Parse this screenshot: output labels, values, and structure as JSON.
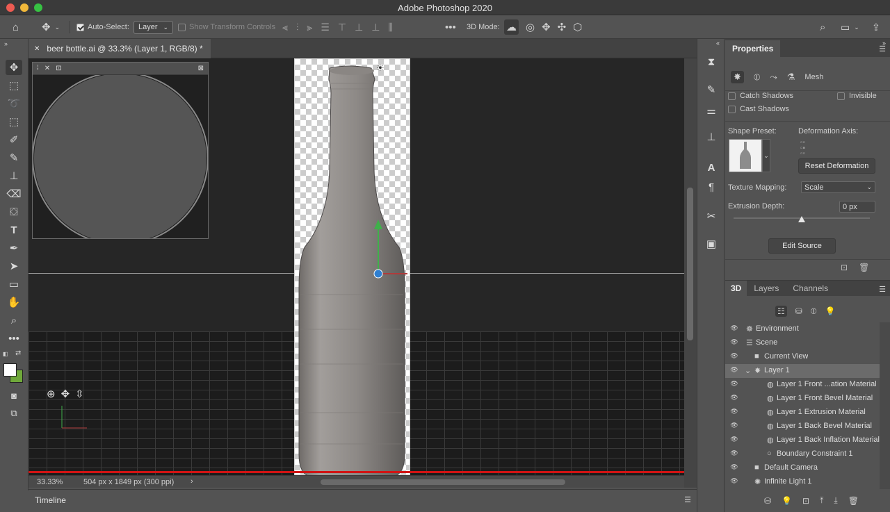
{
  "app": {
    "title": "Adobe Photoshop 2020"
  },
  "options_bar": {
    "auto_select_label": "Auto-Select:",
    "auto_select_value": "Layer",
    "show_transform_label": "Show Transform Controls",
    "mode_3d_label": "3D Mode:"
  },
  "document": {
    "tab_title": "beer bottle.ai @ 33.3% (Layer 1, RGB/8) *",
    "zoom": "33.33%",
    "dimensions": "504 px x 1849 px (300 ppi)"
  },
  "timeline": {
    "label": "Timeline"
  },
  "properties": {
    "tab_label": "Properties",
    "mesh_label": "Mesh",
    "catch_shadows": "Catch Shadows",
    "invisible": "Invisible",
    "cast_shadows": "Cast Shadows",
    "shape_preset_label": "Shape Preset:",
    "deformation_axis_label": "Deformation Axis:",
    "reset_deformation": "Reset Deformation",
    "texture_mapping_label": "Texture Mapping:",
    "texture_mapping_value": "Scale",
    "extrusion_depth_label": "Extrusion Depth:",
    "extrusion_depth_value": "0 px",
    "extrusion_slider_level": 0.5,
    "edit_source": "Edit Source"
  },
  "panel3d": {
    "tabs": [
      "3D",
      "Layers",
      "Channels"
    ],
    "items": [
      {
        "label": "Environment",
        "icon": "environment-icon"
      },
      {
        "label": "Scene",
        "icon": "scene-icon"
      },
      {
        "label": "Current View",
        "icon": "camera-icon"
      },
      {
        "label": "Layer 1",
        "icon": "mesh-icon",
        "selected": true
      },
      {
        "label": "Layer 1 Front ...ation Material",
        "icon": "material-icon"
      },
      {
        "label": "Layer 1 Front Bevel Material",
        "icon": "material-icon"
      },
      {
        "label": "Layer 1 Extrusion Material",
        "icon": "material-icon"
      },
      {
        "label": "Layer 1 Back Bevel Material",
        "icon": "material-icon"
      },
      {
        "label": "Layer 1 Back Inflation Material",
        "icon": "material-icon"
      },
      {
        "label": "Boundary Constraint 1",
        "icon": "constraint-icon"
      },
      {
        "label": "Default Camera",
        "icon": "camera-icon"
      },
      {
        "label": "Infinite Light 1",
        "icon": "light-icon"
      }
    ]
  },
  "colors": {
    "foreground": "#ffffff",
    "background": "#6fa83a",
    "selection_red": "#d01414"
  }
}
